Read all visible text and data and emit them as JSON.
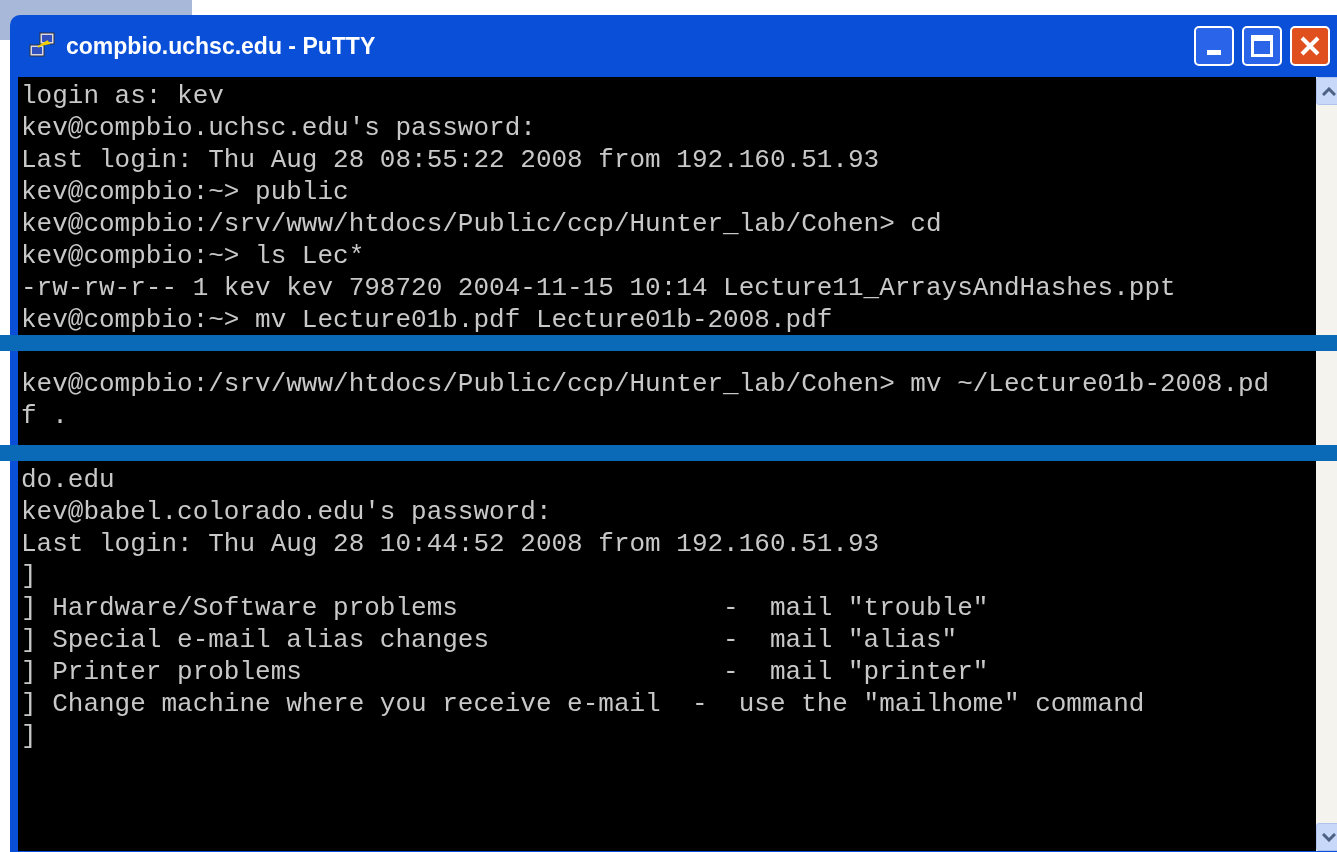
{
  "window": {
    "title": "compbio.uchsc.edu - PuTTY"
  },
  "terminal": {
    "segments": [
      [
        "login as: kev",
        "kev@compbio.uchsc.edu's password:",
        "Last login: Thu Aug 28 08:55:22 2008 from 192.160.51.93",
        "kev@compbio:~> public",
        "kev@compbio:/srv/www/htdocs/Public/ccp/Hunter_lab/Cohen> cd",
        "kev@compbio:~> ls Lec*",
        "-rw-rw-r-- 1 kev kev 798720 2004-11-15 10:14 Lecture11_ArraysAndHashes.ppt",
        "kev@compbio:~> mv Lecture01b.pdf Lecture01b-2008.pdf"
      ],
      [
        "kev@compbio:/srv/www/htdocs/Public/ccp/Hunter_lab/Cohen> mv ~/Lecture01b-2008.pd",
        "f ."
      ],
      [
        "do.edu",
        "kev@babel.colorado.edu's password:",
        "Last login: Thu Aug 28 10:44:52 2008 from 192.160.51.93",
        "]",
        "] Hardware/Software problems                 -  mail \"trouble\"",
        "] Special e-mail alias changes               -  mail \"alias\"",
        "] Printer problems                           -  mail \"printer\"",
        "] Change machine where you receive e-mail  -  use the \"mailhome\" command",
        "]"
      ]
    ]
  }
}
